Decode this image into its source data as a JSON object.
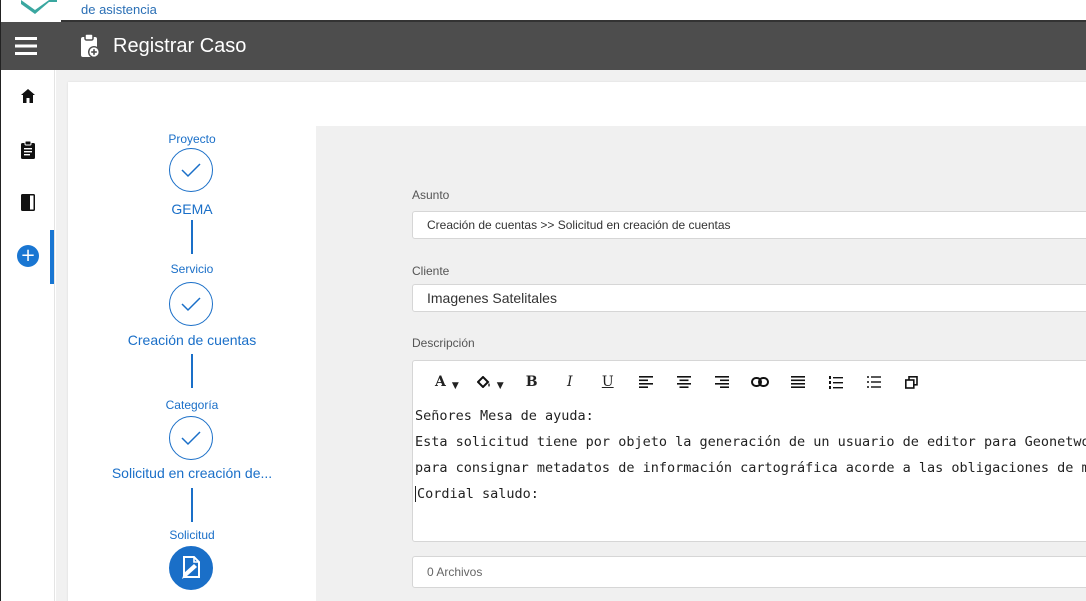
{
  "app": {
    "logo_text": "de asistencia",
    "page_title": "Registrar Caso"
  },
  "sidebar": {
    "items": [
      {
        "icon": "home-icon"
      },
      {
        "icon": "clipboard-icon"
      },
      {
        "icon": "book-icon"
      },
      {
        "icon": "add-circle-icon",
        "active": true
      }
    ]
  },
  "stepper": {
    "steps": [
      {
        "label": "Proyecto",
        "value": "GEMA",
        "state": "done"
      },
      {
        "label": "Servicio",
        "value": "Creación de cuentas",
        "state": "done"
      },
      {
        "label": "Categoría",
        "value": "Solicitud en creación de...",
        "state": "done"
      },
      {
        "label": "Solicitud",
        "value": "",
        "state": "current"
      }
    ]
  },
  "form": {
    "asunto_label": "Asunto",
    "asunto_value": "Creación de cuentas  >> Solicitud en creación de cuentas",
    "cliente_label": "Cliente",
    "cliente_value": "Imagenes Satelitales",
    "descripcion_label": "Descripción",
    "toolbar": {
      "font_color": "A",
      "bold": "B",
      "italic": "I",
      "underline": "U"
    },
    "descripcion_lines": [
      "Señores Mesa de ayuda:",
      "Esta solicitud tiene por objeto la generación de un usuario de editor para Geonetwork",
      "para consignar metadatos de información cartográfica acorde a las obligaciones de mi cargo",
      "Cordial saludo:"
    ],
    "files_label": "0 Archivos"
  },
  "colors": {
    "header_bg": "#4d4d4d",
    "accent": "#1976d2"
  }
}
